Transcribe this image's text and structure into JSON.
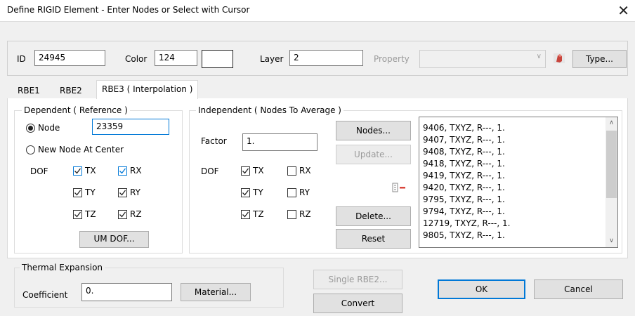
{
  "window": {
    "title": "Define RIGID Element - Enter Nodes or Select with Cursor",
    "close_glyph": "✕"
  },
  "top": {
    "id_label": "ID",
    "id_value": "24945",
    "color_label": "Color",
    "color_value": "124",
    "color_swatch": "#ffffff",
    "layer_label": "Layer",
    "layer_value": "2",
    "property_label": "Property",
    "property_value": "",
    "property_icon": "property-icon",
    "type_button": "Type..."
  },
  "tabs": [
    {
      "label": "RBE1",
      "active": false
    },
    {
      "label": "RBE2",
      "active": false
    },
    {
      "label": "RBE3 ( Interpolation )",
      "active": true
    }
  ],
  "dependent": {
    "title": "Dependent ( Reference )",
    "node_option": "Node",
    "node_value": "23359",
    "new_node_option": "New Node At Center",
    "dof_label": "DOF",
    "dofs": [
      {
        "label": "TX",
        "checked": true
      },
      {
        "label": "RX",
        "checked": true
      },
      {
        "label": "TY",
        "checked": true
      },
      {
        "label": "RY",
        "checked": true
      },
      {
        "label": "TZ",
        "checked": true
      },
      {
        "label": "RZ",
        "checked": true
      }
    ],
    "um_dof_button": "UM DOF..."
  },
  "independent": {
    "title": "Independent ( Nodes To Average )",
    "factor_label": "Factor",
    "factor_value": "1.",
    "dof_label": "DOF",
    "dofs": [
      {
        "label": "TX",
        "checked": true
      },
      {
        "label": "RX",
        "checked": false
      },
      {
        "label": "TY",
        "checked": true
      },
      {
        "label": "RY",
        "checked": false
      },
      {
        "label": "TZ",
        "checked": true
      },
      {
        "label": "RZ",
        "checked": false
      }
    ],
    "nodes_button": "Nodes...",
    "update_button": "Update...",
    "remove_icon": "remove-list-icon",
    "delete_button": "Delete...",
    "reset_button": "Reset",
    "list": [
      "9406, TXYZ, R---, 1.",
      "9407, TXYZ, R---, 1.",
      "9408, TXYZ, R---, 1.",
      "9418, TXYZ, R---, 1.",
      "9419, TXYZ, R---, 1.",
      "9420, TXYZ, R---, 1.",
      "9795, TXYZ, R---, 1.",
      "9794, TXYZ, R---, 1.",
      "12719, TXYZ, R---, 1.",
      "9805, TXYZ, R---, 1."
    ]
  },
  "thermal": {
    "title": "Thermal Expansion",
    "coefficient_label": "Coefficient",
    "coefficient_value": "0.",
    "material_button": "Material..."
  },
  "actions": {
    "single_rbe2": "Single RBE2...",
    "convert": "Convert",
    "ok": "OK",
    "cancel": "Cancel"
  }
}
